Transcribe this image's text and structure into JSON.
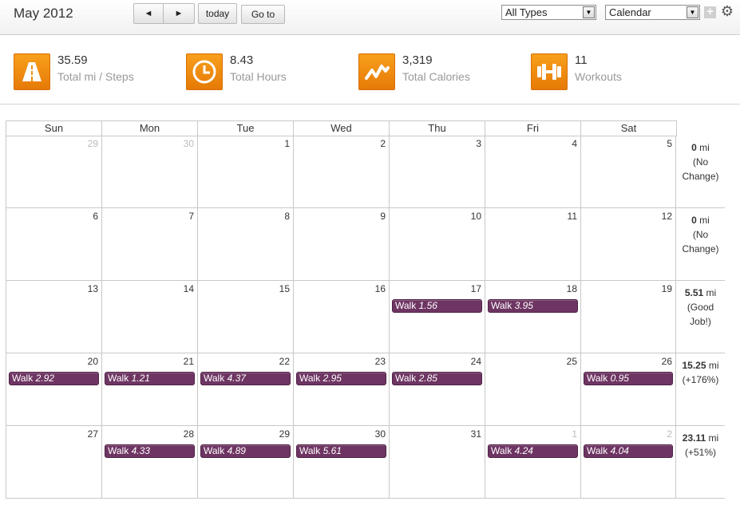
{
  "toolbar": {
    "title": "May 2012",
    "prev_glyph": "◄",
    "next_glyph": "►",
    "today_label": "today",
    "goto_label": "Go to",
    "types_select": "All Types",
    "view_select": "Calendar",
    "plus_glyph": "+",
    "gear_glyph": "⚙"
  },
  "stats": [
    {
      "value": "35.59",
      "label": "Total mi / Steps",
      "icon": "road-icon"
    },
    {
      "value": "8.43",
      "label": "Total Hours",
      "icon": "clock-icon"
    },
    {
      "value": "3,319",
      "label": "Total Calories",
      "icon": "zigzag-icon"
    },
    {
      "value": "11",
      "label": "Workouts",
      "icon": "dumbbell-icon"
    }
  ],
  "weekdays": [
    "Sun",
    "Mon",
    "Tue",
    "Wed",
    "Thu",
    "Fri",
    "Sat"
  ],
  "weeks": [
    {
      "days": [
        {
          "num": "29",
          "other": true
        },
        {
          "num": "30",
          "other": true
        },
        {
          "num": "1"
        },
        {
          "num": "2"
        },
        {
          "num": "3"
        },
        {
          "num": "4"
        },
        {
          "num": "5"
        }
      ],
      "summary": {
        "miles": "0",
        "unit": "mi",
        "note": "(No Change)"
      }
    },
    {
      "days": [
        {
          "num": "6"
        },
        {
          "num": "7"
        },
        {
          "num": "8"
        },
        {
          "num": "9"
        },
        {
          "num": "10"
        },
        {
          "num": "11"
        },
        {
          "num": "12"
        }
      ],
      "summary": {
        "miles": "0",
        "unit": "mi",
        "note": "(No Change)"
      }
    },
    {
      "days": [
        {
          "num": "13"
        },
        {
          "num": "14"
        },
        {
          "num": "15"
        },
        {
          "num": "16"
        },
        {
          "num": "17",
          "event": {
            "type": "Walk",
            "distance": "1.56"
          }
        },
        {
          "num": "18",
          "event": {
            "type": "Walk",
            "distance": "3.95"
          }
        },
        {
          "num": "19"
        }
      ],
      "summary": {
        "miles": "5.51",
        "unit": "mi",
        "note": "(Good Job!)"
      }
    },
    {
      "days": [
        {
          "num": "20",
          "event": {
            "type": "Walk",
            "distance": "2.92"
          }
        },
        {
          "num": "21",
          "event": {
            "type": "Walk",
            "distance": "1.21"
          }
        },
        {
          "num": "22",
          "event": {
            "type": "Walk",
            "distance": "4.37"
          }
        },
        {
          "num": "23",
          "event": {
            "type": "Walk",
            "distance": "2.95"
          }
        },
        {
          "num": "24",
          "event": {
            "type": "Walk",
            "distance": "2.85"
          }
        },
        {
          "num": "25"
        },
        {
          "num": "26",
          "event": {
            "type": "Walk",
            "distance": "0.95"
          }
        }
      ],
      "summary": {
        "miles": "15.25",
        "unit": "mi",
        "note": "(+176%)"
      }
    },
    {
      "days": [
        {
          "num": "27"
        },
        {
          "num": "28",
          "event": {
            "type": "Walk",
            "distance": "4.33"
          }
        },
        {
          "num": "29",
          "event": {
            "type": "Walk",
            "distance": "4.89"
          }
        },
        {
          "num": "30",
          "event": {
            "type": "Walk",
            "distance": "5.61"
          }
        },
        {
          "num": "31"
        },
        {
          "num": "1",
          "other": true,
          "event": {
            "type": "Walk",
            "distance": "4.24"
          }
        },
        {
          "num": "2",
          "other": true,
          "event": {
            "type": "Walk",
            "distance": "4.04"
          }
        }
      ],
      "summary": {
        "miles": "23.11",
        "unit": "mi",
        "note": "(+51%)"
      }
    }
  ],
  "colors": {
    "accent_orange": "#f18c10",
    "event_purple": "#6e3563"
  }
}
